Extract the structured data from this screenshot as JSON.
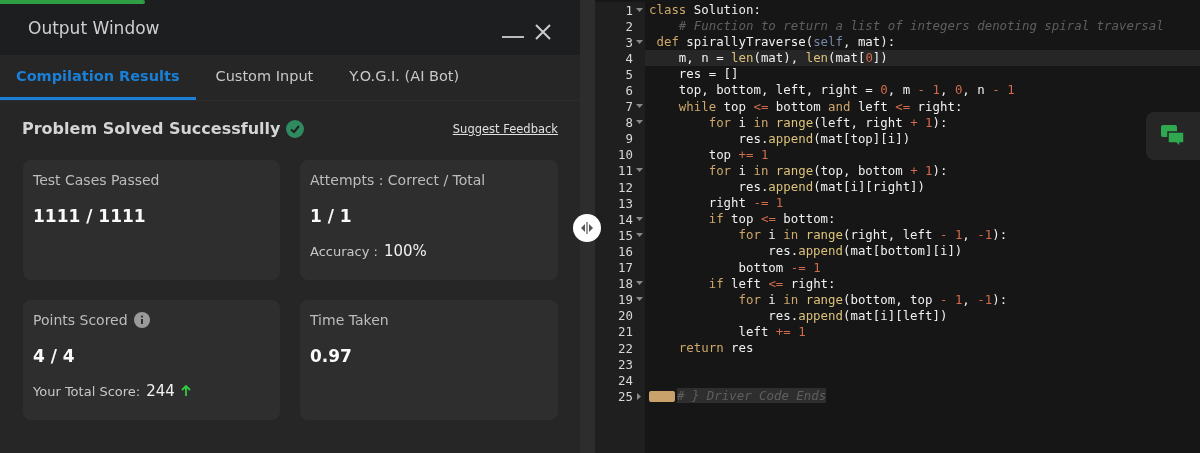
{
  "output_window": {
    "progress": {
      "level": 0.25
    },
    "title": "Output Window",
    "tabs": [
      {
        "label": "Compilation Results",
        "selected": true
      },
      {
        "label": "Custom Input",
        "selected": false
      },
      {
        "label": "Y.O.G.I. (AI Bot)",
        "selected": false
      }
    ],
    "status": "Problem Solved Successfully",
    "feedback_link": "Suggest Feedback",
    "cards": [
      {
        "label": "Test Cases Passed",
        "value": "1111 / 1111",
        "info": false,
        "trend_up": false
      },
      {
        "label": "Attempts : Correct / Total",
        "value": "1 / 1",
        "extra_label": "Accuracy :",
        "extra_value": "100%",
        "info": false,
        "trend_up": false
      },
      {
        "label": "Points Scored",
        "info": true,
        "value": "4 / 4",
        "extra_label": "Your Total Score:",
        "extra_value": "244",
        "trend_up": true
      },
      {
        "label": "Time Taken",
        "value": "0.97",
        "info": false,
        "trend_up": false
      }
    ]
  },
  "editor": {
    "lines": [
      {
        "number": "1",
        "foldable": true,
        "folded": false,
        "active": false,
        "tokens": [
          {
            "kind": "kw",
            "text": "class"
          },
          {
            "kind": "t",
            "text": " Solution:"
          }
        ]
      },
      {
        "number": "2",
        "foldable": false,
        "folded": false,
        "active": false,
        "tokens": [
          {
            "kind": "cm",
            "text": "    # Function to return a list of integers denoting spiral traversal"
          }
        ]
      },
      {
        "number": "3",
        "foldable": true,
        "folded": false,
        "active": false,
        "tokens": [
          {
            "kind": "kw",
            "text": " def"
          },
          {
            "kind": "t",
            "text": " spirallyTraverse("
          },
          {
            "kind": "sf",
            "text": "self"
          },
          {
            "kind": "t",
            "text": ", mat):"
          }
        ]
      },
      {
        "number": "4",
        "foldable": false,
        "folded": false,
        "active": true,
        "tokens": [
          {
            "kind": "t",
            "text": "    m, n = "
          },
          {
            "kind": "fn",
            "text": "len"
          },
          {
            "kind": "t",
            "text": "(mat), "
          },
          {
            "kind": "fn",
            "text": "len"
          },
          {
            "kind": "t",
            "text": "(mat["
          },
          {
            "kind": "nm",
            "text": "0"
          },
          {
            "kind": "t",
            "text": "])"
          }
        ]
      },
      {
        "number": "5",
        "foldable": false,
        "folded": false,
        "active": false,
        "tokens": [
          {
            "kind": "t",
            "text": "    res = []"
          }
        ]
      },
      {
        "number": "6",
        "foldable": false,
        "folded": false,
        "active": false,
        "tokens": [
          {
            "kind": "t",
            "text": "    top, bottom, left, right = "
          },
          {
            "kind": "nm",
            "text": "0"
          },
          {
            "kind": "t",
            "text": ", m "
          },
          {
            "kind": "op",
            "text": "-"
          },
          {
            "kind": "nm",
            "text": " 1"
          },
          {
            "kind": "t",
            "text": ", "
          },
          {
            "kind": "nm",
            "text": "0"
          },
          {
            "kind": "t",
            "text": ", n "
          },
          {
            "kind": "op",
            "text": "-"
          },
          {
            "kind": "nm",
            "text": " 1"
          }
        ]
      },
      {
        "number": "7",
        "foldable": true,
        "folded": false,
        "active": false,
        "tokens": [
          {
            "kind": "kw",
            "text": "    while"
          },
          {
            "kind": "t",
            "text": " top "
          },
          {
            "kind": "op",
            "text": "<="
          },
          {
            "kind": "t",
            "text": " bottom "
          },
          {
            "kind": "kw",
            "text": "and"
          },
          {
            "kind": "t",
            "text": " left "
          },
          {
            "kind": "op",
            "text": "<="
          },
          {
            "kind": "t",
            "text": " right:"
          }
        ]
      },
      {
        "number": "8",
        "foldable": true,
        "folded": false,
        "active": false,
        "tokens": [
          {
            "kind": "kw",
            "text": "        for"
          },
          {
            "kind": "t",
            "text": " i "
          },
          {
            "kind": "kw",
            "text": "in"
          },
          {
            "kind": "fn",
            "text": " range"
          },
          {
            "kind": "t",
            "text": "(left, right "
          },
          {
            "kind": "op",
            "text": "+"
          },
          {
            "kind": "nm",
            "text": " 1"
          },
          {
            "kind": "t",
            "text": "):"
          }
        ]
      },
      {
        "number": "9",
        "foldable": false,
        "folded": false,
        "active": false,
        "tokens": [
          {
            "kind": "t",
            "text": "            res."
          },
          {
            "kind": "fn",
            "text": "append"
          },
          {
            "kind": "t",
            "text": "(mat[top][i])"
          }
        ]
      },
      {
        "number": "10",
        "foldable": false,
        "folded": false,
        "active": false,
        "tokens": [
          {
            "kind": "t",
            "text": "        top "
          },
          {
            "kind": "op",
            "text": "+="
          },
          {
            "kind": "nm",
            "text": " 1"
          }
        ]
      },
      {
        "number": "11",
        "foldable": true,
        "folded": false,
        "active": false,
        "tokens": [
          {
            "kind": "kw",
            "text": "        for"
          },
          {
            "kind": "t",
            "text": " i "
          },
          {
            "kind": "kw",
            "text": "in"
          },
          {
            "kind": "fn",
            "text": " range"
          },
          {
            "kind": "t",
            "text": "(top, bottom "
          },
          {
            "kind": "op",
            "text": "+"
          },
          {
            "kind": "nm",
            "text": " 1"
          },
          {
            "kind": "t",
            "text": "):"
          }
        ]
      },
      {
        "number": "12",
        "foldable": false,
        "folded": false,
        "active": false,
        "tokens": [
          {
            "kind": "t",
            "text": "            res."
          },
          {
            "kind": "fn",
            "text": "append"
          },
          {
            "kind": "t",
            "text": "(mat[i][right])"
          }
        ]
      },
      {
        "number": "13",
        "foldable": false,
        "folded": false,
        "active": false,
        "tokens": [
          {
            "kind": "t",
            "text": "        right "
          },
          {
            "kind": "op",
            "text": "-="
          },
          {
            "kind": "nm",
            "text": " 1"
          }
        ]
      },
      {
        "number": "14",
        "foldable": true,
        "folded": false,
        "active": false,
        "tokens": [
          {
            "kind": "kw",
            "text": "        if"
          },
          {
            "kind": "t",
            "text": " top "
          },
          {
            "kind": "op",
            "text": "<="
          },
          {
            "kind": "t",
            "text": " bottom:"
          }
        ]
      },
      {
        "number": "15",
        "foldable": true,
        "folded": false,
        "active": false,
        "tokens": [
          {
            "kind": "kw",
            "text": "            for"
          },
          {
            "kind": "t",
            "text": " i "
          },
          {
            "kind": "kw",
            "text": "in"
          },
          {
            "kind": "fn",
            "text": " range"
          },
          {
            "kind": "t",
            "text": "(right, left "
          },
          {
            "kind": "op",
            "text": "-"
          },
          {
            "kind": "nm",
            "text": " 1"
          },
          {
            "kind": "t",
            "text": ", "
          },
          {
            "kind": "nm",
            "text": "-1"
          },
          {
            "kind": "t",
            "text": "):"
          }
        ]
      },
      {
        "number": "16",
        "foldable": false,
        "folded": false,
        "active": false,
        "tokens": [
          {
            "kind": "t",
            "text": "                res."
          },
          {
            "kind": "fn",
            "text": "append"
          },
          {
            "kind": "t",
            "text": "(mat[bottom][i])"
          }
        ]
      },
      {
        "number": "17",
        "foldable": false,
        "folded": false,
        "active": false,
        "tokens": [
          {
            "kind": "t",
            "text": "            bottom "
          },
          {
            "kind": "op",
            "text": "-="
          },
          {
            "kind": "nm",
            "text": " 1"
          }
        ]
      },
      {
        "number": "18",
        "foldable": true,
        "folded": false,
        "active": false,
        "tokens": [
          {
            "kind": "kw",
            "text": "        if"
          },
          {
            "kind": "t",
            "text": " left "
          },
          {
            "kind": "op",
            "text": "<="
          },
          {
            "kind": "t",
            "text": " right:"
          }
        ]
      },
      {
        "number": "19",
        "foldable": true,
        "folded": false,
        "active": false,
        "tokens": [
          {
            "kind": "kw",
            "text": "            for"
          },
          {
            "kind": "t",
            "text": " i "
          },
          {
            "kind": "kw",
            "text": "in"
          },
          {
            "kind": "fn",
            "text": " range"
          },
          {
            "kind": "t",
            "text": "(bottom, top "
          },
          {
            "kind": "op",
            "text": "-"
          },
          {
            "kind": "nm",
            "text": " 1"
          },
          {
            "kind": "t",
            "text": ", "
          },
          {
            "kind": "nm",
            "text": "-1"
          },
          {
            "kind": "t",
            "text": "):"
          }
        ]
      },
      {
        "number": "20",
        "foldable": false,
        "folded": false,
        "active": false,
        "tokens": [
          {
            "kind": "t",
            "text": "                res."
          },
          {
            "kind": "fn",
            "text": "append"
          },
          {
            "kind": "t",
            "text": "(mat[i][left])"
          }
        ]
      },
      {
        "number": "21",
        "foldable": false,
        "folded": false,
        "active": false,
        "tokens": [
          {
            "kind": "t",
            "text": "            left "
          },
          {
            "kind": "op",
            "text": "+="
          },
          {
            "kind": "nm",
            "text": " 1"
          }
        ]
      },
      {
        "number": "22",
        "foldable": false,
        "folded": false,
        "active": false,
        "tokens": [
          {
            "kind": "kw",
            "text": "    return"
          },
          {
            "kind": "t",
            "text": " res"
          }
        ]
      },
      {
        "number": "23",
        "foldable": false,
        "folded": false,
        "active": false
      },
      {
        "number": "24",
        "foldable": false,
        "folded": false,
        "active": false
      },
      {
        "number": "25",
        "foldable": true,
        "folded": true,
        "active": false,
        "tokens": [
          {
            "kind": "cm",
            "text": "# } Driver Code Ends"
          }
        ]
      }
    ]
  }
}
